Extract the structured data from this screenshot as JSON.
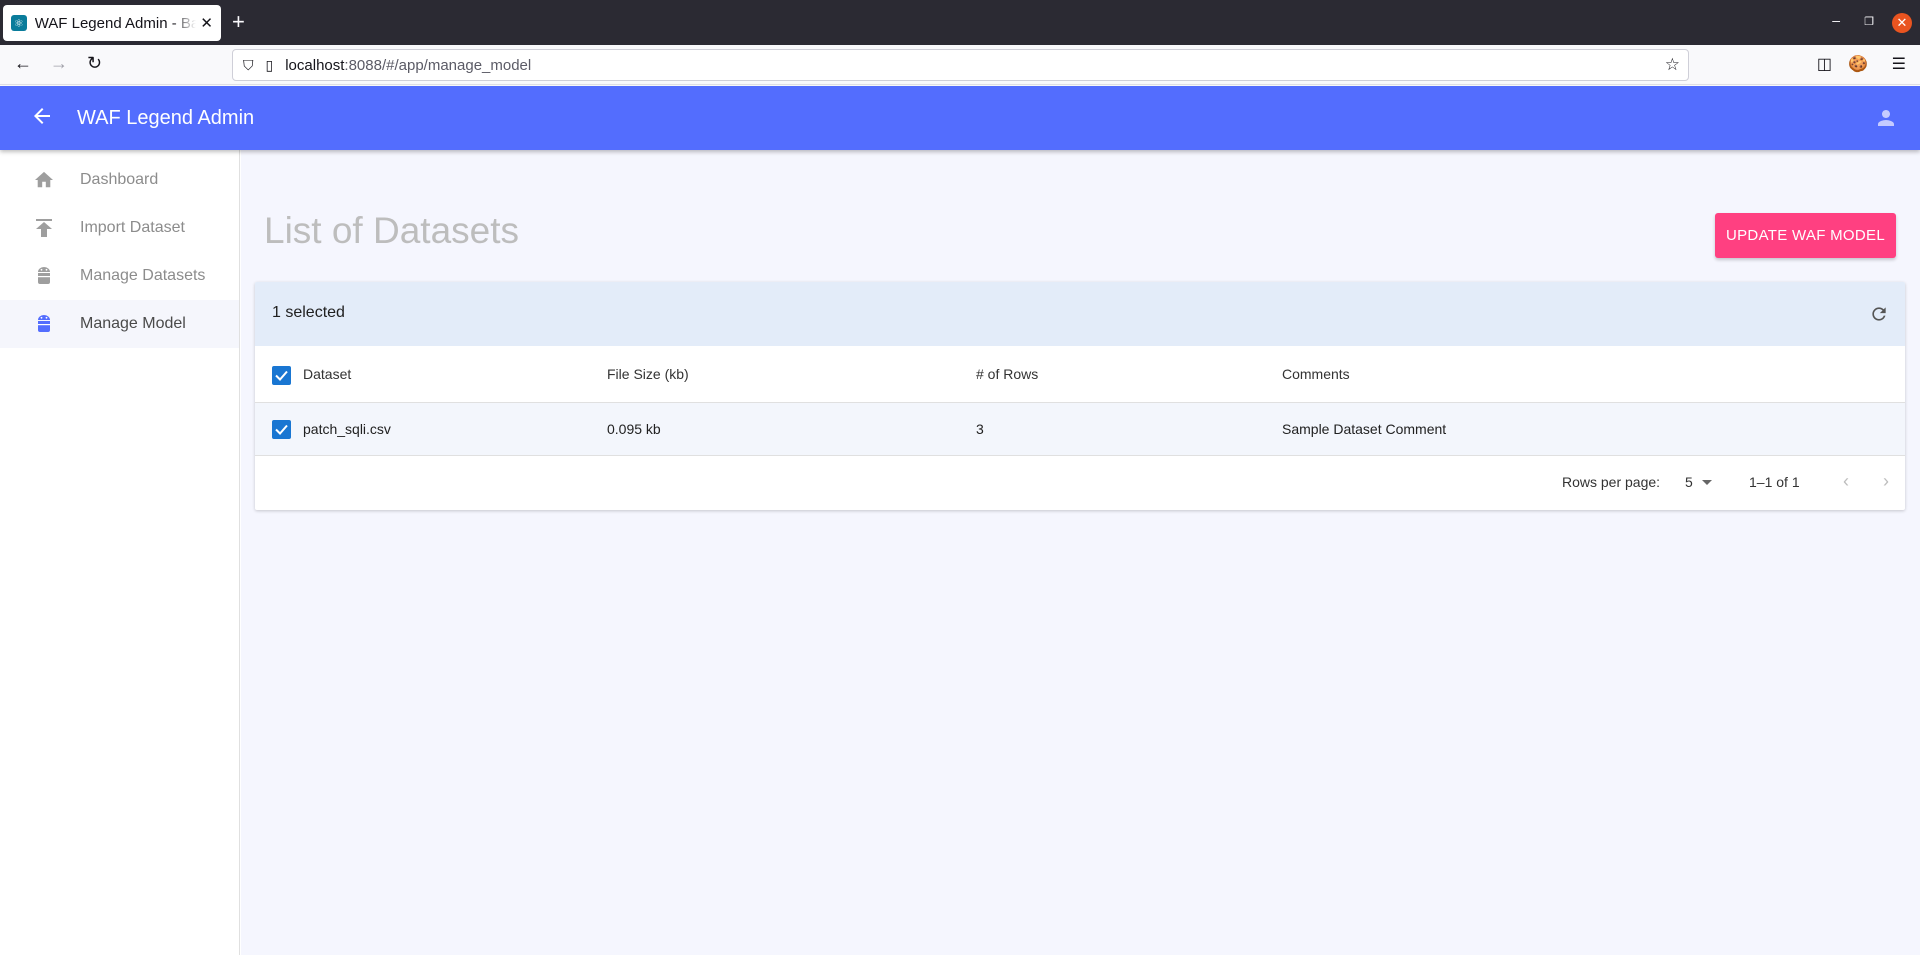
{
  "browser": {
    "tab_title": "WAF Legend Admin - Bandit",
    "url_host": "localhost",
    "url_rest": ":8088/#/app/manage_model"
  },
  "appbar": {
    "title": "WAF Legend Admin"
  },
  "sidebar": {
    "items": [
      {
        "label": "Dashboard",
        "icon": "home-icon",
        "active": false
      },
      {
        "label": "Import Dataset",
        "icon": "upload-icon",
        "active": false
      },
      {
        "label": "Manage Datasets",
        "icon": "android-icon",
        "active": false
      },
      {
        "label": "Manage Model",
        "icon": "android-icon",
        "active": true
      }
    ]
  },
  "main": {
    "title": "List of Datasets",
    "update_button": "UPDATE WAF MODEL",
    "table": {
      "selected_text": "1 selected",
      "columns": [
        "Dataset",
        "File Size (kb)",
        "# of Rows",
        "Comments"
      ],
      "rows": [
        {
          "dataset": "patch_sqli.csv",
          "file_size": "0.095 kb",
          "rows": "3",
          "comments": "Sample Dataset Comment",
          "checked": true
        }
      ],
      "rows_per_page_label": "Rows per page:",
      "rows_per_page": "5",
      "range": "1–1 of 1"
    }
  },
  "colors": {
    "appbar": "#536dfe",
    "accent": "#ff4081",
    "checkbox": "#1976d2"
  }
}
